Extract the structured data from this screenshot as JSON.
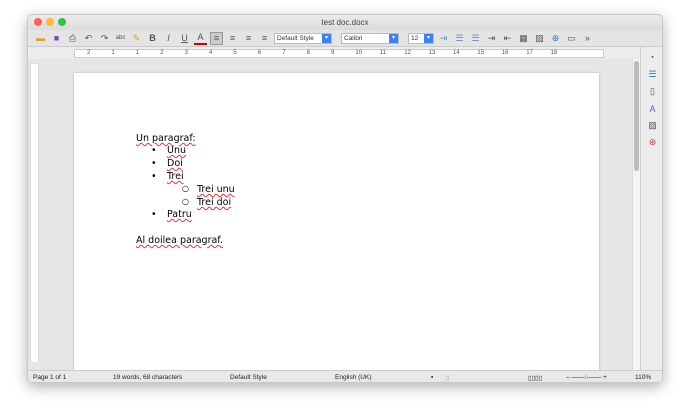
{
  "window": {
    "title": "test doc.docx"
  },
  "toolbar": {
    "paragraph_style": "Default Style",
    "font_name": "Calibri",
    "font_size": "12",
    "bold": "B",
    "italic": "I",
    "underline": "U",
    "font_color": "A",
    "font_color_hex": "#cc0000"
  },
  "ruler": {
    "ticks": [
      "2",
      "1",
      "1",
      "2",
      "3",
      "4",
      "5",
      "6",
      "7",
      "8",
      "9",
      "10",
      "11",
      "12",
      "13",
      "14",
      "15",
      "16",
      "17",
      "18"
    ]
  },
  "document": {
    "para1": "Un paragraf:",
    "bullets": [
      "Unu",
      "Doi",
      "Trei"
    ],
    "sub_bullets": [
      "Trei unu",
      "Trei doi"
    ],
    "bullet_last": "Patru",
    "para2": "Al doilea paragraf."
  },
  "status": {
    "page": "Page 1 of 1",
    "words": "19 words, 68 characters",
    "style": "Default Style",
    "language": "English (UK)",
    "zoom": "110%"
  }
}
